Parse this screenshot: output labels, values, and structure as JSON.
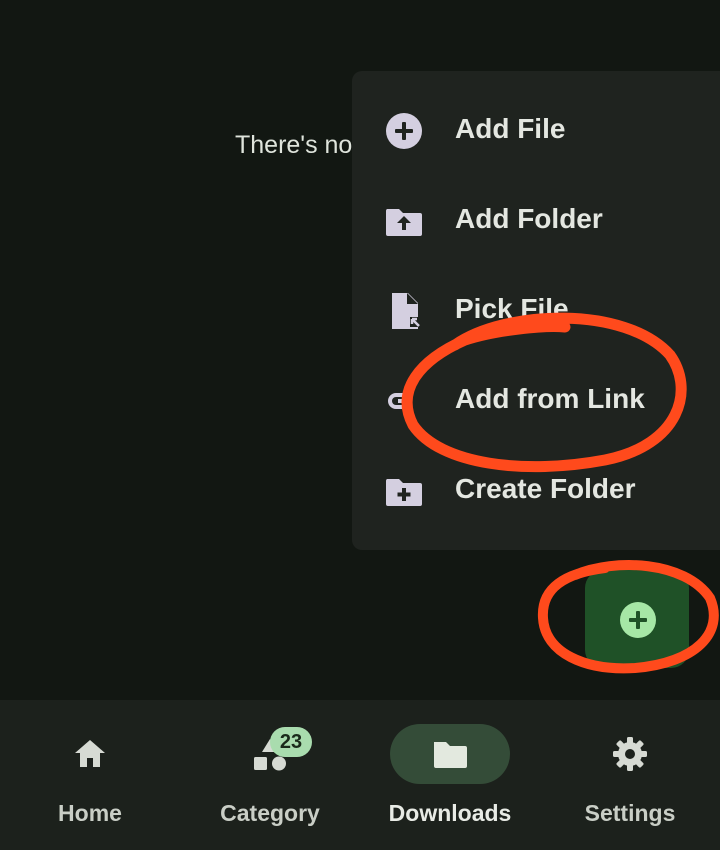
{
  "main": {
    "empty_message": "There's no"
  },
  "add_menu": {
    "items": [
      {
        "label": "Add File",
        "icon": "add-circle-icon"
      },
      {
        "label": "Add Folder",
        "icon": "folder-upload-icon"
      },
      {
        "label": "Pick File",
        "icon": "file-pick-icon"
      },
      {
        "label": "Add from Link",
        "icon": "link-icon"
      },
      {
        "label": "Create Folder",
        "icon": "create-folder-icon"
      }
    ]
  },
  "fab": {
    "icon": "add-circle-icon"
  },
  "bottom_nav": {
    "items": [
      {
        "label": "Home",
        "icon": "home-icon",
        "active": false
      },
      {
        "label": "Category",
        "icon": "category-icon",
        "active": false,
        "badge": "23"
      },
      {
        "label": "Downloads",
        "icon": "folder-icon",
        "active": true
      },
      {
        "label": "Settings",
        "icon": "gear-icon",
        "active": false
      }
    ]
  },
  "colors": {
    "background": "#121712",
    "menu_surface": "#1f231f",
    "fab": "#1f5127",
    "fab_icon": "#a6e7a6",
    "active_pill": "#344c38",
    "badge": "#a9dcae",
    "annotation": "#ff4a1c"
  }
}
